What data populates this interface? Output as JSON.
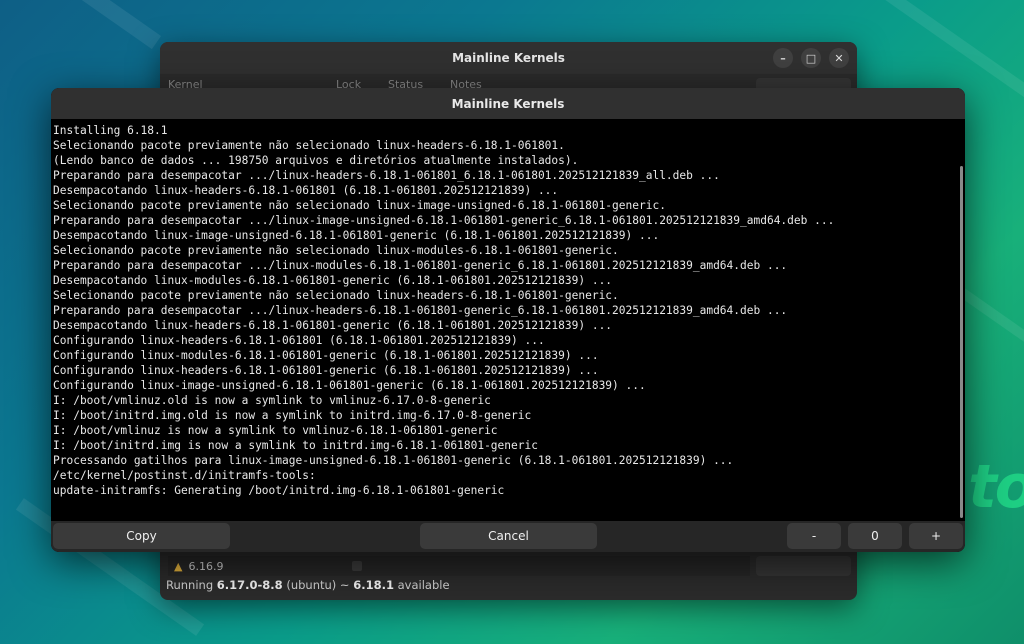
{
  "back_window": {
    "title": "Mainline Kernels",
    "window_controls": [
      "minimize-icon",
      "maximize-icon",
      "close-icon"
    ],
    "columns": [
      "Kernel",
      "Lock",
      "Status",
      "Notes"
    ],
    "row": {
      "icon": "tux-icon",
      "kernel": "6.16.9"
    },
    "status": {
      "prefix": "Running ",
      "running": "6.17.0-8.8",
      "middle": " (ubuntu) ~ ",
      "available": "6.18.1",
      "suffix": " available"
    }
  },
  "front_window": {
    "title": "Mainline Kernels",
    "lines": [
      "Installing 6.18.1",
      "Selecionando pacote previamente não selecionado linux-headers-6.18.1-061801.",
      "(Lendo banco de dados ... 198750 arquivos e diretórios atualmente instalados).",
      "Preparando para desempacotar .../linux-headers-6.18.1-061801_6.18.1-061801.202512121839_all.deb ...",
      "Desempacotando linux-headers-6.18.1-061801 (6.18.1-061801.202512121839) ...",
      "Selecionando pacote previamente não selecionado linux-image-unsigned-6.18.1-061801-generic.",
      "Preparando para desempacotar .../linux-image-unsigned-6.18.1-061801-generic_6.18.1-061801.202512121839_amd64.deb ...",
      "Desempacotando linux-image-unsigned-6.18.1-061801-generic (6.18.1-061801.202512121839) ...",
      "Selecionando pacote previamente não selecionado linux-modules-6.18.1-061801-generic.",
      "Preparando para desempacotar .../linux-modules-6.18.1-061801-generic_6.18.1-061801.202512121839_amd64.deb ...",
      "Desempacotando linux-modules-6.18.1-061801-generic (6.18.1-061801.202512121839) ...",
      "Selecionando pacote previamente não selecionado linux-headers-6.18.1-061801-generic.",
      "Preparando para desempacotar .../linux-headers-6.18.1-061801-generic_6.18.1-061801.202512121839_amd64.deb ...",
      "Desempacotando linux-headers-6.18.1-061801-generic (6.18.1-061801.202512121839) ...",
      "Configurando linux-headers-6.18.1-061801 (6.18.1-061801.202512121839) ...",
      "Configurando linux-modules-6.18.1-061801-generic (6.18.1-061801.202512121839) ...",
      "Configurando linux-headers-6.18.1-061801-generic (6.18.1-061801.202512121839) ...",
      "Configurando linux-image-unsigned-6.18.1-061801-generic (6.18.1-061801.202512121839) ...",
      "I: /boot/vmlinuz.old is now a symlink to vmlinuz-6.17.0-8-generic",
      "I: /boot/initrd.img.old is now a symlink to initrd.img-6.17.0-8-generic",
      "I: /boot/vmlinuz is now a symlink to vmlinuz-6.18.1-061801-generic",
      "I: /boot/initrd.img is now a symlink to initrd.img-6.18.1-061801-generic",
      "Processando gatilhos para linux-image-unsigned-6.18.1-061801-generic (6.18.1-061801.202512121839) ...",
      "/etc/kernel/postinst.d/initramfs-tools:",
      "update-initramfs: Generating /boot/initrd.img-6.18.1-061801-generic",
      "",
      "_"
    ],
    "buttons": {
      "copy": "Copy",
      "cancel": "Cancel",
      "minus": "-",
      "value": "0",
      "plus": "+"
    }
  },
  "wallpaper_text": "to",
  "colors": {
    "terminal_bg": "#000000",
    "titlebar": "#303030",
    "accent_green": "#20d486"
  }
}
